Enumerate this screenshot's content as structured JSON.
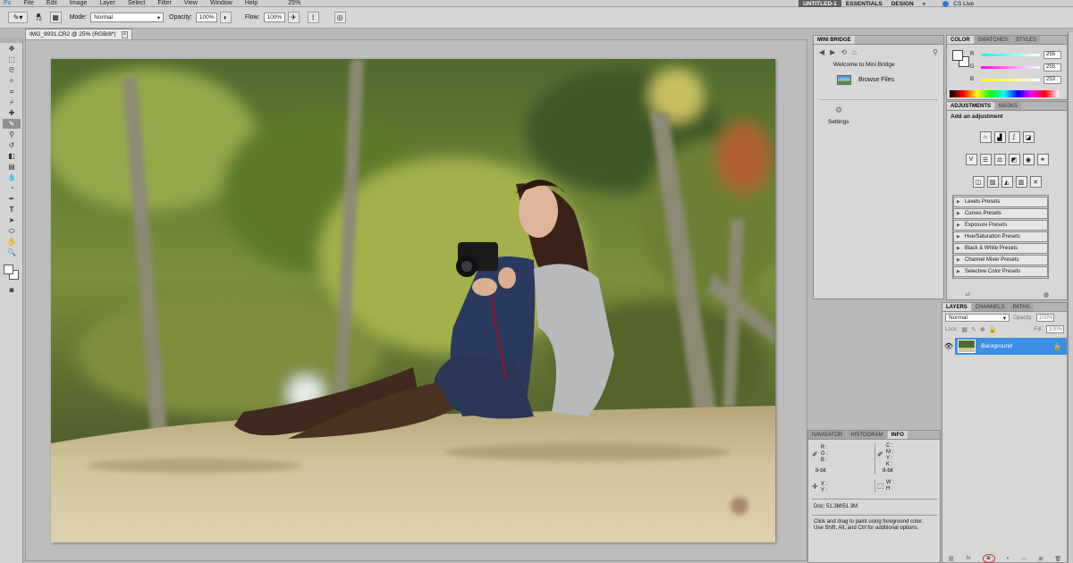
{
  "menubar": {
    "logo": "Ps",
    "items": [
      "File",
      "Edit",
      "Image",
      "Layer",
      "Select",
      "Filter",
      "View",
      "Window",
      "Help"
    ],
    "zoom": "25%"
  },
  "workspace": {
    "items": [
      "UNTITLED-1",
      "ESSENTIALS",
      "DESIGN",
      "»"
    ],
    "cs_live": "CS Live"
  },
  "options": {
    "brush_size": "72",
    "mode_label": "Mode:",
    "mode_value": "Normal",
    "opacity_label": "Opacity:",
    "opacity_value": "100%",
    "flow_label": "Flow:",
    "flow_value": "100%"
  },
  "document": {
    "tab_title": "IMG_9931.CR2 @ 25% (RGB/8*)",
    "close": "×"
  },
  "mini_bridge": {
    "tab": "MINI BRIDGE",
    "welcome": "Welcome to Mini Bridge",
    "browse": "Browse Files",
    "settings": "Settings"
  },
  "color_panel": {
    "tabs": [
      "COLOR",
      "SWATCHES",
      "STYLES"
    ],
    "channels": [
      {
        "label": "R",
        "value": "255"
      },
      {
        "label": "G",
        "value": "255"
      },
      {
        "label": "B",
        "value": "253"
      }
    ]
  },
  "adjustments": {
    "tabs": [
      "ADJUSTMENTS",
      "MASKS"
    ],
    "heading": "Add an adjustment",
    "presets": [
      "Levels Presets",
      "Curves Presets",
      "Exposure Presets",
      "Hue/Saturation Presets",
      "Black & White Presets",
      "Channel Mixer Presets",
      "Selective Color Presets"
    ]
  },
  "layers": {
    "tabs": [
      "LAYERS",
      "CHANNELS",
      "PATHS"
    ],
    "blend": "Normal",
    "opacity_label": "Opacity:",
    "opacity_value": "100%",
    "lock_label": "Lock:",
    "fill_label": "Fill:",
    "fill_value": "100%",
    "layer_name": "Background"
  },
  "info_panel": {
    "tabs": [
      "NAVIGATOR",
      "HISTOGRAM",
      "INFO"
    ],
    "rgb": [
      "R :",
      "G :",
      "B :"
    ],
    "cmyk": [
      "C :",
      "M :",
      "Y :",
      "K :"
    ],
    "bit_left": "8-bit",
    "bit_right": "8-bit",
    "xy": [
      "X :",
      "Y :"
    ],
    "wh": [
      "W :",
      "H :"
    ],
    "doc": "Doc: 51.3M/51.3M",
    "hint": "Click and drag to paint using foreground color.  Use Shift, Alt, and Ctrl for additional options."
  },
  "colors": {
    "layer_selected": "#3c8fe3",
    "highlight_ring": "#e02020"
  }
}
